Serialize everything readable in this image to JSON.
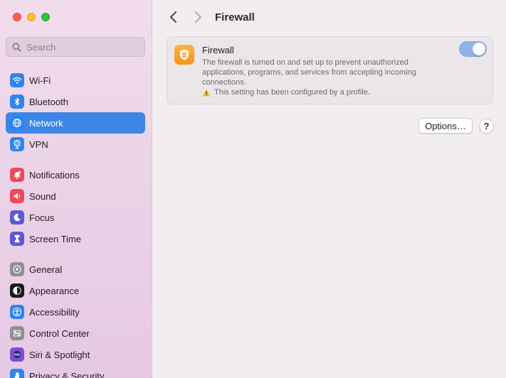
{
  "search": {
    "placeholder": "Search"
  },
  "sidebar": {
    "groups": [
      [
        {
          "label": "Wi-Fi",
          "icon": "wifi-icon",
          "color": "#2f84f0"
        },
        {
          "label": "Bluetooth",
          "icon": "bluetooth-icon",
          "color": "#2f84f0"
        },
        {
          "label": "Network",
          "icon": "globe-icon",
          "color": "#2f84f0",
          "active": true
        },
        {
          "label": "VPN",
          "icon": "vpn-globe-icon",
          "color": "#2f84f0"
        }
      ],
      [
        {
          "label": "Notifications",
          "icon": "bell-icon",
          "color": "#f0485a"
        },
        {
          "label": "Sound",
          "icon": "speaker-icon",
          "color": "#f0485a"
        },
        {
          "label": "Focus",
          "icon": "moon-icon",
          "color": "#5d5ad6"
        },
        {
          "label": "Screen Time",
          "icon": "hourglass-icon",
          "color": "#5d5ad6"
        }
      ],
      [
        {
          "label": "General",
          "icon": "gear-icon",
          "color": "#8e8e93"
        },
        {
          "label": "Appearance",
          "icon": "appearance-icon",
          "color": "#1c1c1e"
        },
        {
          "label": "Accessibility",
          "icon": "accessibility-icon",
          "color": "#2f84f0"
        },
        {
          "label": "Control Center",
          "icon": "control-center-icon",
          "color": "#8e8e93"
        },
        {
          "label": "Siri & Spotlight",
          "icon": "siri-icon",
          "color": "#7b4fd6"
        },
        {
          "label": "Privacy & Security",
          "icon": "hand-icon",
          "color": "#2f84f0"
        }
      ]
    ]
  },
  "toolbar": {
    "title": "Firewall"
  },
  "firewall": {
    "heading": "Firewall",
    "description": "The firewall is turned on and set up to prevent unauthorized applications, programs, and services from accepting incoming connections.",
    "warning": "This setting has been configured by a profile.",
    "enabled": true
  },
  "buttons": {
    "options": "Options…",
    "help": "?"
  },
  "colors": {
    "accent": "#3d86e6",
    "firewall_icon": "#f7931e",
    "toggle": "#8fb2e8"
  }
}
